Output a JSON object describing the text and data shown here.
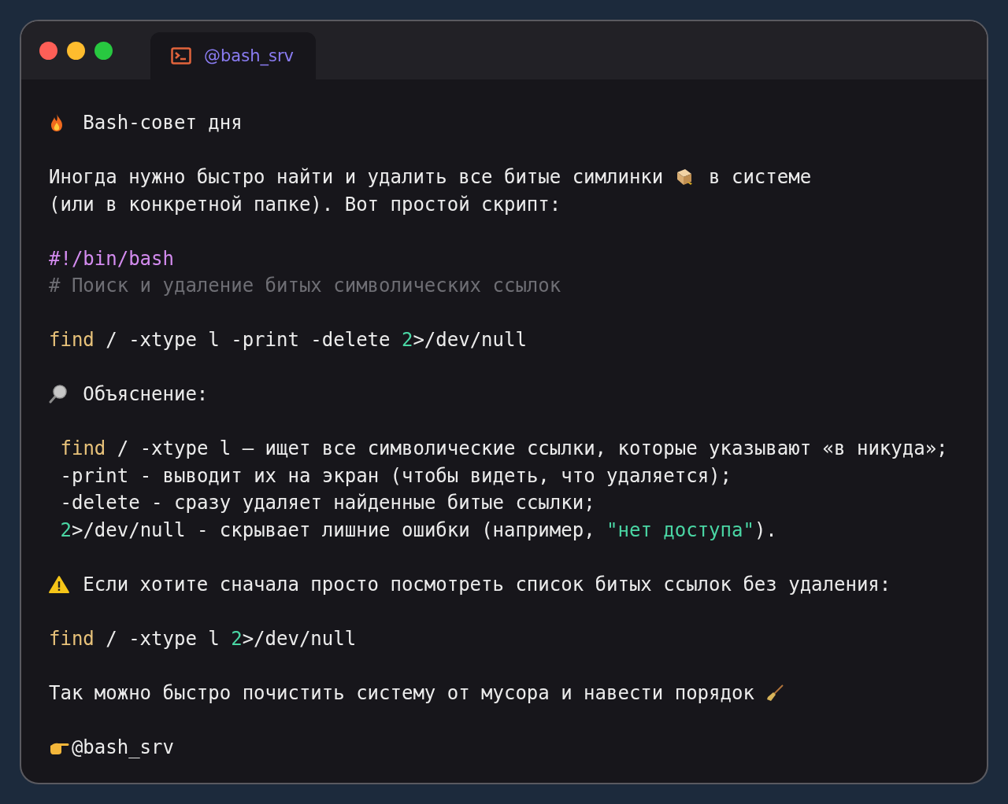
{
  "window": {
    "tab": {
      "label": "@bash_srv",
      "selected": true
    }
  },
  "lines": [
    {
      "kind": "text",
      "segments": [
        {
          "kind": "icon"
        },
        {
          "kind": "plain",
          "text": " Bash-совет дня"
        }
      ]
    },
    {
      "kind": "blank"
    },
    {
      "kind": "text",
      "segments": [
        {
          "kind": "plain",
          "text": "Иногда нужно быстро найти и удалить все битые симлинки "
        },
        {
          "kind": "icon"
        },
        {
          "kind": "plain",
          "text": " в системе"
        }
      ]
    },
    {
      "kind": "text",
      "segments": [
        {
          "kind": "plain",
          "text": "(или в конкретной папке). Вот простой скрипт:"
        }
      ]
    },
    {
      "kind": "blank"
    },
    {
      "kind": "code",
      "segments": [
        {
          "kind": "shebang",
          "text": "#!/bin/bash"
        }
      ]
    },
    {
      "kind": "code",
      "segments": [
        {
          "kind": "comment",
          "text": "# Поиск и удаление битых символических ссылок"
        }
      ]
    },
    {
      "kind": "blank"
    },
    {
      "kind": "code",
      "segments": [
        {
          "kind": "keyword",
          "text": "find"
        },
        {
          "kind": "plain",
          "text": " / -xtype l -print -delete "
        },
        {
          "kind": "number",
          "text": "2"
        },
        {
          "kind": "plain",
          "text": ">/dev/null"
        }
      ]
    },
    {
      "kind": "blank"
    },
    {
      "kind": "text",
      "segments": [
        {
          "kind": "icon"
        },
        {
          "kind": "plain",
          "text": " Объяснение:"
        }
      ]
    },
    {
      "kind": "blank"
    },
    {
      "kind": "item",
      "segments": [
        {
          "kind": "keyword",
          "text": "find"
        },
        {
          "kind": "plain",
          "text": " / -xtype l — ищет все символические ссылки, которые указывают «в никуда»;"
        }
      ]
    },
    {
      "kind": "item",
      "segments": [
        {
          "kind": "plain",
          "text": "-print - выводит их на экран (чтобы видеть, что удаляется);"
        }
      ]
    },
    {
      "kind": "item",
      "segments": [
        {
          "kind": "plain",
          "text": "-delete - сразу удаляет найденные битые ссылки;"
        }
      ]
    },
    {
      "kind": "item",
      "segments": [
        {
          "kind": "number",
          "text": "2"
        },
        {
          "kind": "plain",
          "text": ">/dev/null - скрывает лишние ошибки (например, "
        },
        {
          "kind": "string",
          "text": "\"нет доступа\""
        },
        {
          "kind": "plain",
          "text": ")."
        }
      ]
    },
    {
      "kind": "blank"
    },
    {
      "kind": "text",
      "segments": [
        {
          "kind": "icon"
        },
        {
          "kind": "plain",
          "text": " Если хотите сначала просто посмотреть список битых ссылок без удаления:"
        }
      ]
    },
    {
      "kind": "blank"
    },
    {
      "kind": "code",
      "segments": [
        {
          "kind": "keyword",
          "text": "find"
        },
        {
          "kind": "plain",
          "text": " / -xtype l "
        },
        {
          "kind": "number",
          "text": "2"
        },
        {
          "kind": "plain",
          "text": ">/dev/null"
        }
      ]
    },
    {
      "kind": "blank"
    },
    {
      "kind": "text",
      "segments": [
        {
          "kind": "plain",
          "text": "Так можно быстро почистить систему от мусора и навести порядок "
        },
        {
          "kind": "icon"
        }
      ]
    },
    {
      "kind": "blank"
    },
    {
      "kind": "text",
      "segments": [
        {
          "kind": "icon"
        },
        {
          "kind": "plain",
          "text": "@bash_srv"
        }
      ]
    }
  ]
}
